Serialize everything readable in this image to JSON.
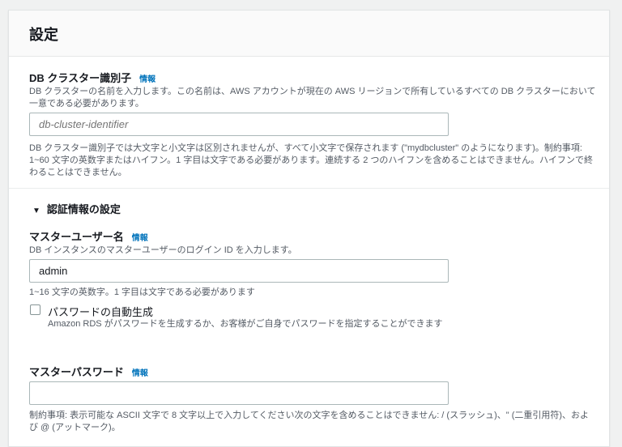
{
  "section_title": "設定",
  "cluster_id": {
    "label": "DB クラスター識別子",
    "info": "情報",
    "description": "DB クラスターの名前を入力します。この名前は、AWS アカウントが現在の AWS リージョンで所有しているすべての DB クラスターにおいて一意である必要があります。",
    "placeholder": "db-cluster-identifier",
    "value": "",
    "hint": "DB クラスター識別子では大文字と小文字は区別されませんが、すべて小文字で保存されます (\"mydbcluster\" のようになります)。制約事項: 1~60 文字の英数字またはハイフン。1 字目は文字である必要があります。連続する 2 つのハイフンを含めることはできません。ハイフンで終わることはできません。"
  },
  "credentials": {
    "toggle_label": "認証情報の設定",
    "expanded": true,
    "master_username": {
      "label": "マスターユーザー名",
      "info": "情報",
      "description": "DB インスタンスのマスターユーザーのログイン ID を入力します。",
      "value": "admin",
      "hint": "1~16 文字の英数字。1 字目は文字である必要があります"
    },
    "auto_generate": {
      "label": "パスワードの自動生成",
      "checked": false,
      "description": "Amazon RDS がパスワードを生成するか、お客様がご自身でパスワードを指定することができます"
    },
    "master_password": {
      "label": "マスターパスワード",
      "info": "情報",
      "value": "",
      "hint": "制約事項: 表示可能な ASCII 文字で 8 文字以上で入力してください次の文字を含めることはできません: / (スラッシュ)、\" (二重引用符)、および @ (アットマーク)。"
    }
  }
}
